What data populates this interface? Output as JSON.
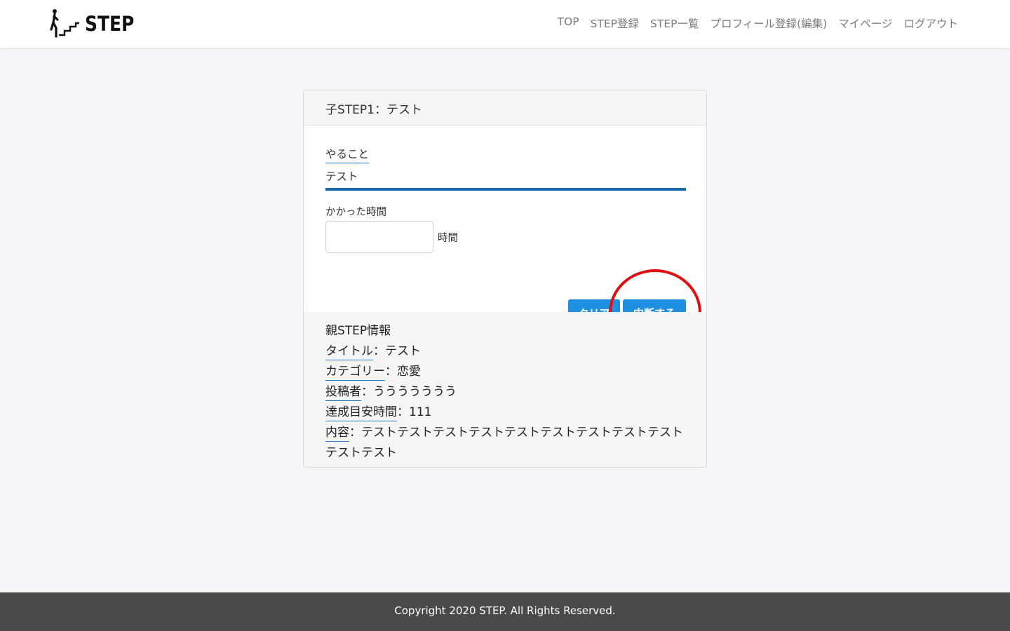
{
  "brand": {
    "name": "STEP"
  },
  "nav": [
    "TOP",
    "STEP登録",
    "STEP一覧",
    "プロフィール登録(編集)",
    "マイページ",
    "ログアウト"
  ],
  "card": {
    "title": "子STEP1：テスト",
    "todo_label": "やること",
    "todo_value": "テスト",
    "time_label": "かかった時間",
    "time_value": "",
    "time_unit": "時間",
    "clear_label": "クリア",
    "stop_label": "中断する"
  },
  "parent": {
    "heading": "親STEP情報",
    "sep": "：",
    "title_key": "タイトル",
    "title_value": "テスト",
    "category_key": "カテゴリー",
    "category_value": "恋愛",
    "author_key": "投稿者",
    "author_value": "ううううううう",
    "time_key": "達成目安時間",
    "time_value": "111",
    "content_key": "内容",
    "content_value": "テストテストテストテストテストテストテストテストテストテストテスト"
  },
  "footer": {
    "copyright": "Copyright 2020 STEP. All Rights Reserved."
  },
  "colors": {
    "accent": "#1e8fe1",
    "highlight_circle": "#e01010",
    "footer_bg": "#4a4a4a"
  }
}
